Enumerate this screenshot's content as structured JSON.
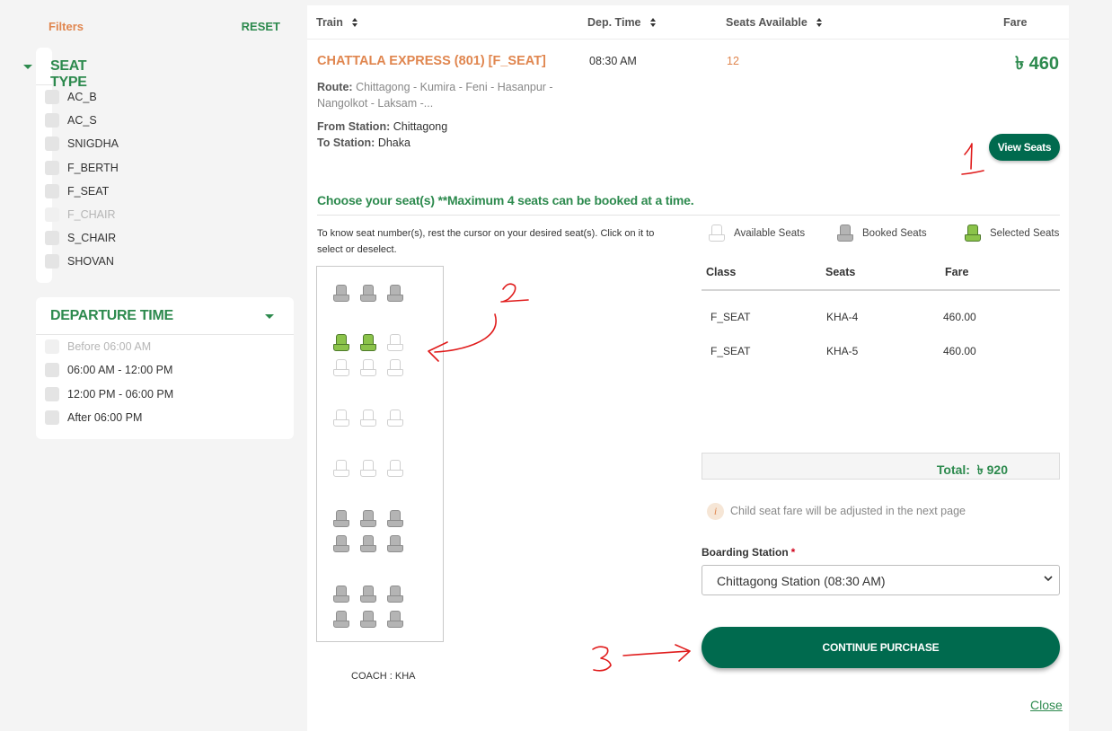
{
  "sidebar": {
    "filters_label": "Filters",
    "reset_label": "RESET",
    "seat_type": {
      "title": "SEAT TYPE",
      "options": [
        {
          "label": "AC_B",
          "disabled": false
        },
        {
          "label": "AC_S",
          "disabled": false
        },
        {
          "label": "SNIGDHA",
          "disabled": false
        },
        {
          "label": "F_BERTH",
          "disabled": false
        },
        {
          "label": "F_SEAT",
          "disabled": false
        },
        {
          "label": "F_CHAIR",
          "disabled": true
        },
        {
          "label": "S_CHAIR",
          "disabled": false
        },
        {
          "label": "SHOVAN",
          "disabled": false
        }
      ]
    },
    "departure_time": {
      "title": "DEPARTURE TIME",
      "options": [
        {
          "label": "Before 06:00 AM",
          "disabled": true
        },
        {
          "label": "06:00 AM - 12:00 PM",
          "disabled": false
        },
        {
          "label": "12:00 PM - 06:00 PM",
          "disabled": false
        },
        {
          "label": "After 06:00 PM",
          "disabled": false
        }
      ]
    }
  },
  "table_header": {
    "train": "Train",
    "dep_time": "Dep. Time",
    "seats_available": "Seats Available",
    "fare": "Fare"
  },
  "train": {
    "name": "CHATTALA EXPRESS (801) [F_SEAT]",
    "dep_time": "08:30 AM",
    "seats_available": "12",
    "fare": "৳ 460",
    "route_label": "Route:",
    "route_line1": "Chittagong - Kumira - Feni - Hasanpur -",
    "route_line2": "Nangolkot - Laksam -...",
    "from_label": "From Station:",
    "from_value": "Chittagong",
    "to_label": "To Station:",
    "to_value": "Dhaka",
    "view_seats_label": "View Seats"
  },
  "seat_selection": {
    "heading": "Choose your seat(s) **Maximum 4 seats can be booked at a time.",
    "hint": "To know seat number(s), rest the cursor on your desired seat(s). Click on it to select or deselect.",
    "coach_label": "COACH : KHA",
    "layout_rows": [
      [
        "booked",
        "booked",
        "booked"
      ],
      [
        "selected",
        "selected",
        "available"
      ],
      [
        "available",
        "available",
        "available"
      ],
      [
        "available",
        "available",
        "available"
      ],
      [
        "available",
        "available",
        "available"
      ],
      [
        "booked",
        "booked",
        "booked"
      ],
      [
        "booked",
        "booked",
        "booked"
      ],
      [
        "booked",
        "booked",
        "booked"
      ],
      [
        "booked",
        "booked",
        "booked"
      ]
    ],
    "legend": {
      "available": "Available Seats",
      "booked": "Booked Seats",
      "selected": "Selected Seats"
    }
  },
  "fare_table": {
    "headers": {
      "class": "Class",
      "seats": "Seats",
      "fare": "Fare"
    },
    "rows": [
      {
        "class": "F_SEAT",
        "seat": "KHA-4",
        "fare": "460.00"
      },
      {
        "class": "F_SEAT",
        "seat": "KHA-5",
        "fare": "460.00"
      }
    ],
    "total_label": "Total:",
    "total_value": "৳ 920"
  },
  "info": {
    "icon": "info-icon",
    "text": "Child seat fare will be adjusted in the next page"
  },
  "boarding": {
    "label": "Boarding Station",
    "required_mark": "*",
    "selected": "Chittagong Station (08:30 AM)"
  },
  "actions": {
    "continue_label": "CONTINUE PURCHASE",
    "close_label": "Close"
  },
  "annotations": {
    "color": "#e01b1b",
    "marks": [
      "1",
      "2",
      "3"
    ]
  },
  "colors": {
    "brand_green": "#006a4e",
    "accent_green": "#2d8a4e",
    "accent_orange": "#e0864f",
    "selected_seat": "#8bc34a",
    "booked_seat": "#b4b4b4"
  }
}
